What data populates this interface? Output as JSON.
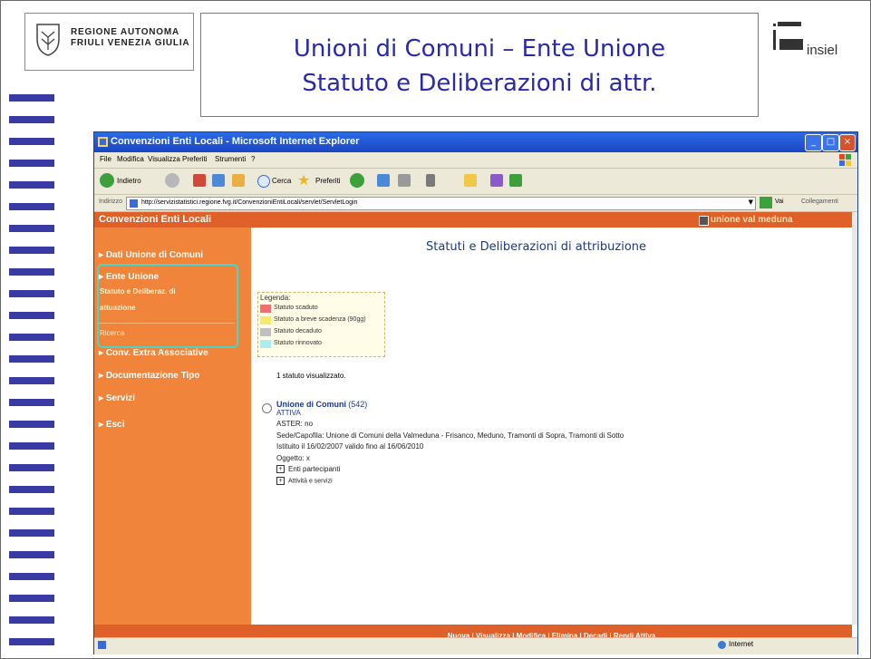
{
  "slide": {
    "logo_line1": "REGIONE AUTONOMA",
    "logo_line2": "FRIULI VENEZIA GIULIA",
    "title_line1": "Unioni di Comuni – Ente Unione",
    "title_line2": "Statuto e Deliberazioni di attr.",
    "brand": "insiel"
  },
  "ie": {
    "title": "Convenzioni Enti Locali - Microsoft Internet Explorer",
    "menu": [
      "File",
      "Modifica",
      "Visualizza",
      "Preferiti",
      "Strumenti",
      "?"
    ],
    "toolbar": {
      "back": "Indietro",
      "search": "Cerca",
      "favorites": "Preferiti"
    },
    "address_label": "Indirizzo",
    "address_url": "http://servizistatistici.regione.fvg.it/ConvenzioniEntiLocali/servlet/ServletLogin",
    "go_label": "Vai",
    "links_label": "Collegamenti",
    "status_zone": "Internet"
  },
  "app": {
    "header_title": "Convenzioni Enti Locali",
    "user": "unione val meduna",
    "sidebar": {
      "dati_unione": "Dati Unione di Comuni",
      "ente_unione": "Ente Unione",
      "statuto_line1": "Statuto e Deliberaz. di",
      "statuto_line2": "attuazione",
      "ricerca": "Ricerca",
      "conv_extra": "Conv. Extra Associative",
      "documentazione": "Documentazione Tipo",
      "servizi": "Servizi",
      "esci": "Esci"
    },
    "page_title": "Statuti e Deliberazioni di attribuzione",
    "legend": {
      "title": "Legenda:",
      "items": [
        {
          "label": "Statuto scaduto",
          "color": "#f07070"
        },
        {
          "label": "Statuto a breve scadenza (90gg)",
          "color": "#f5ea6a"
        },
        {
          "label": "Statuto decaduto",
          "color": "#c0c0c0"
        },
        {
          "label": "Statuto rinnovato",
          "color": "#a8eef0"
        }
      ]
    },
    "count_text": "1 statuto visualizzato.",
    "record": {
      "title": "Unione di Comuni",
      "id": "(542)",
      "state": "ATTIVA",
      "aster": "ASTER: no",
      "sede": "Sede/Capofila: Unione di Comuni della Valmeduna - Frisanco, Meduno, Tramonti di Sopra, Tramonti di Sotto",
      "istituto": "Istituito il 16/02/2007 valido fino al 16/06/2010",
      "oggetto": "Oggetto: x",
      "enti": "Enti partecipanti",
      "attivita": "Attività e servizi"
    },
    "footer": "Nuova  |  Visualizza  |  Modifica  |  Elimina  |  Decadi  |  Rendi Attiva"
  }
}
